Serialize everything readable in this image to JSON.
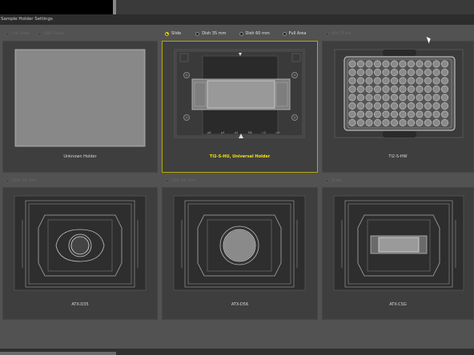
{
  "window": {
    "title": "Sample Holder Settings"
  },
  "colors": {
    "accent": "#e8d80a",
    "selected_label": "#f4e213"
  },
  "top_radios": [
    {
      "label": "Full Area",
      "state": "disabled"
    },
    {
      "label": "Well Plate",
      "state": "disabled"
    },
    {
      "label": "Slide",
      "state": "selected"
    },
    {
      "label": "Dish 35 mm",
      "state": "enabled"
    },
    {
      "label": "Dish 60 mm",
      "state": "enabled"
    },
    {
      "label": "Full Area",
      "state": "enabled"
    },
    {
      "label": "Well Plate",
      "state": "disabled"
    }
  ],
  "mid_radios": [
    {
      "label": "Dish 35 mm",
      "state": "disabled"
    },
    {
      "label": "Dish 60 mm",
      "state": "disabled"
    },
    {
      "label": "Slide",
      "state": "disabled"
    }
  ],
  "holders": [
    {
      "name": "Unknown Holder",
      "selected": false,
      "icon": "blank-holder-icon"
    },
    {
      "name": "TI2-S-HU, Universal Holder",
      "selected": true,
      "icon": "universal-holder-icon"
    },
    {
      "name": "TI2-S-HW",
      "selected": false,
      "icon": "well-plate-holder-icon"
    },
    {
      "name": "ATX-D35",
      "selected": false,
      "icon": "dish35-holder-icon"
    },
    {
      "name": "ATX-D56",
      "selected": false,
      "icon": "dish56-holder-icon"
    },
    {
      "name": "ATX-CSG",
      "selected": false,
      "icon": "coverslip-holder-icon"
    }
  ],
  "universal_scale_marks": [
    "p6",
    "p4",
    "p2",
    "Mk",
    "n2",
    "n4"
  ]
}
